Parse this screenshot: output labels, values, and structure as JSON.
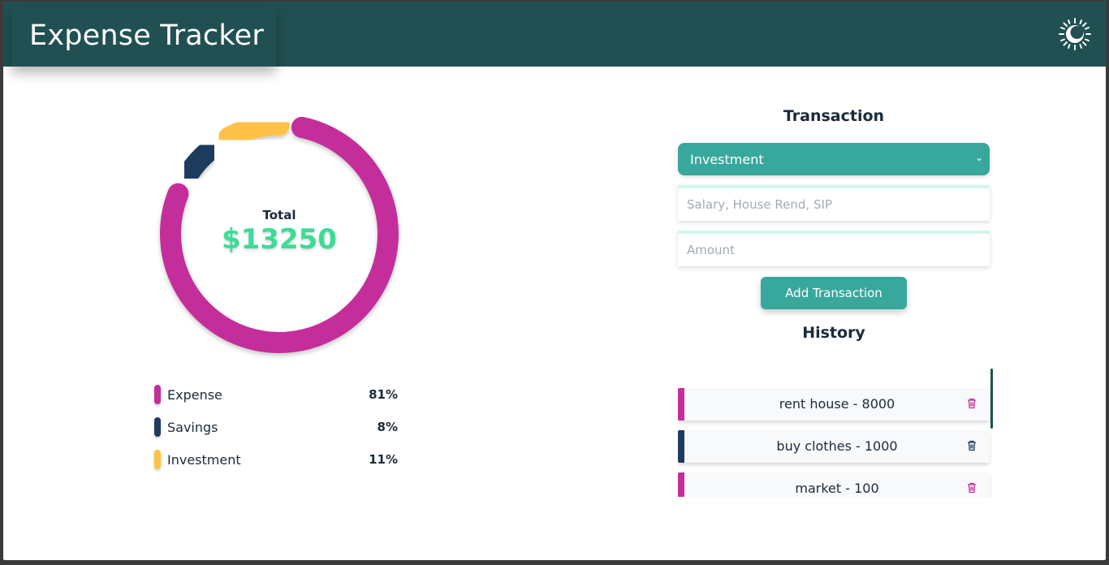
{
  "app": {
    "title": "Expense Tracker"
  },
  "colors": {
    "header": "#215052",
    "expense": "#c42e9b",
    "savings": "#1f3a5f",
    "investment": "#ffc247",
    "accent": "#38a89d",
    "total": "#3ddc97"
  },
  "summary": {
    "total_label": "Total",
    "total_value": "$13250"
  },
  "chart_data": {
    "type": "pie",
    "categories": [
      "Expense",
      "Savings",
      "Investment"
    ],
    "values": [
      81,
      8,
      11
    ],
    "colors": [
      "#c42e9b",
      "#1f3a5f",
      "#ffc247"
    ]
  },
  "legend": [
    {
      "name": "Expense",
      "percent": "81%",
      "color": "#c42e9b"
    },
    {
      "name": "Savings",
      "percent": "8%",
      "color": "#1f3a5f"
    },
    {
      "name": "Investment",
      "percent": "11%",
      "color": "#ffc247"
    }
  ],
  "form": {
    "title": "Transaction",
    "type_selected": "Investment",
    "description_placeholder": "Salary, House Rend, SIP",
    "amount_placeholder": "Amount",
    "submit_label": "Add Transaction"
  },
  "history": {
    "title": "History",
    "items": [
      {
        "text": "rent house - 8000",
        "color": "#c42e9b"
      },
      {
        "text": "buy clothes - 1000",
        "color": "#1f3a5f"
      },
      {
        "text": "market - 100",
        "color": "#c42e9b"
      }
    ]
  },
  "icons": {
    "theme": "sun-icon",
    "delete": "trash-icon",
    "select": "chevron-down-icon"
  }
}
